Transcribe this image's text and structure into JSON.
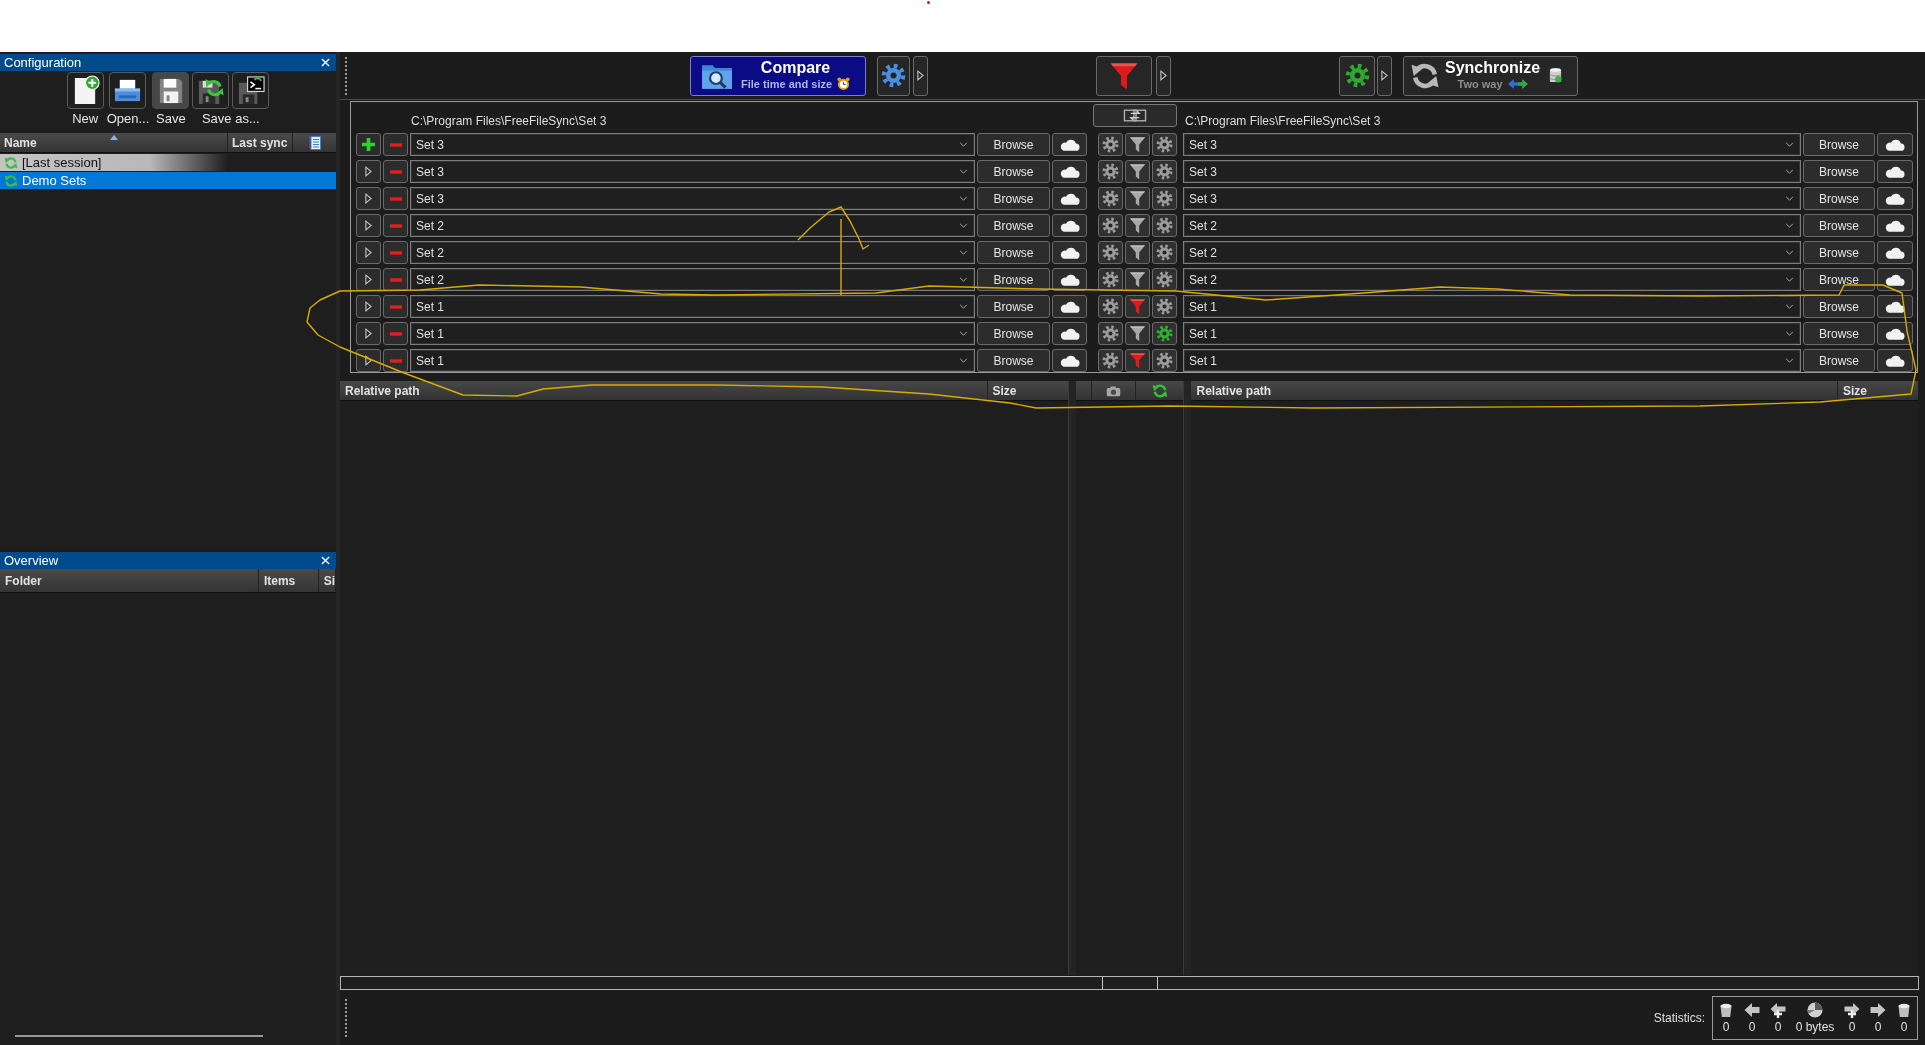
{
  "configuration": {
    "title": "Configuration",
    "toolbar": [
      {
        "kind": "new",
        "label": "New",
        "disabled": false
      },
      {
        "kind": "open",
        "label": "Open...",
        "disabled": false
      },
      {
        "kind": "save",
        "label": "Save",
        "disabled": true
      },
      {
        "kind": "save_as",
        "label": "Save as...",
        "disabled": false
      }
    ],
    "columns": [
      {
        "label": "Name",
        "sorted": true
      },
      {
        "label": "Last sync",
        "sorted": false
      }
    ],
    "rows": [
      {
        "kind": "last_session",
        "name": "[Last session]",
        "selected": false
      },
      {
        "kind": "config",
        "name": "Demo Sets",
        "selected": true
      }
    ]
  },
  "overview": {
    "title": "Overview",
    "columns": [
      "Folder",
      "Items",
      "Si"
    ]
  },
  "main_toolbar": {
    "compare": {
      "label": "Compare",
      "variant": "File time and size"
    },
    "filter_active": true,
    "synchronize": {
      "label": "Synchronize",
      "variant": "Two way"
    }
  },
  "folder_pairs": {
    "left_path": "C:\\Program Files\\FreeFileSync\\Set 3",
    "right_path": "C:\\Program Files\\FreeFileSync\\Set 3",
    "rows": [
      {
        "kind": "main",
        "left": "Set 3",
        "left_browse": "Browse",
        "local_filter": false,
        "local_sync_settings": false,
        "right": "Set 3",
        "right_browse": "Browse"
      },
      {
        "kind": "additional",
        "left": "Set 3",
        "left_browse": "Browse",
        "local_filter": false,
        "local_sync_settings": false,
        "right": "Set 3",
        "right_browse": "Browse"
      },
      {
        "kind": "additional",
        "left": "Set 3",
        "left_browse": "Browse",
        "local_filter": false,
        "local_sync_settings": false,
        "right": "Set 3",
        "right_browse": "Browse"
      },
      {
        "kind": "additional",
        "left": "Set 2",
        "left_browse": "Browse",
        "local_filter": false,
        "local_sync_settings": false,
        "right": "Set 2",
        "right_browse": "Browse"
      },
      {
        "kind": "additional",
        "left": "Set 2",
        "left_browse": "Browse",
        "local_filter": false,
        "local_sync_settings": false,
        "right": "Set 2",
        "right_browse": "Browse"
      },
      {
        "kind": "additional",
        "left": "Set 2",
        "left_browse": "Browse",
        "local_filter": false,
        "local_sync_settings": false,
        "right": "Set 2",
        "right_browse": "Browse"
      },
      {
        "kind": "additional",
        "left": "Set 1",
        "left_browse": "Browse",
        "local_filter": true,
        "local_sync_settings": false,
        "right": "Set 1",
        "right_browse": "Browse"
      },
      {
        "kind": "additional",
        "left": "Set 1",
        "left_browse": "Browse",
        "local_filter": false,
        "local_sync_settings": true,
        "right": "Set 1",
        "right_browse": "Browse"
      },
      {
        "kind": "additional",
        "left": "Set 1",
        "left_browse": "Browse",
        "local_filter": true,
        "local_sync_settings": false,
        "right": "Set 1",
        "right_browse": "Browse"
      }
    ]
  },
  "file_grid": {
    "left_columns": [
      "Relative path",
      "Size"
    ],
    "right_columns": [
      "Relative path",
      "Size"
    ]
  },
  "status_bar": {
    "label": "Statistics:",
    "items": [
      {
        "kind": "delete_left",
        "value": "0"
      },
      {
        "kind": "overwrite_left",
        "value": "0"
      },
      {
        "kind": "create_left",
        "value": "0"
      },
      {
        "kind": "data",
        "value": "0 bytes"
      },
      {
        "kind": "create_right",
        "value": "0"
      },
      {
        "kind": "overwrite_right",
        "value": "0"
      },
      {
        "kind": "delete_right",
        "value": "0"
      }
    ]
  }
}
